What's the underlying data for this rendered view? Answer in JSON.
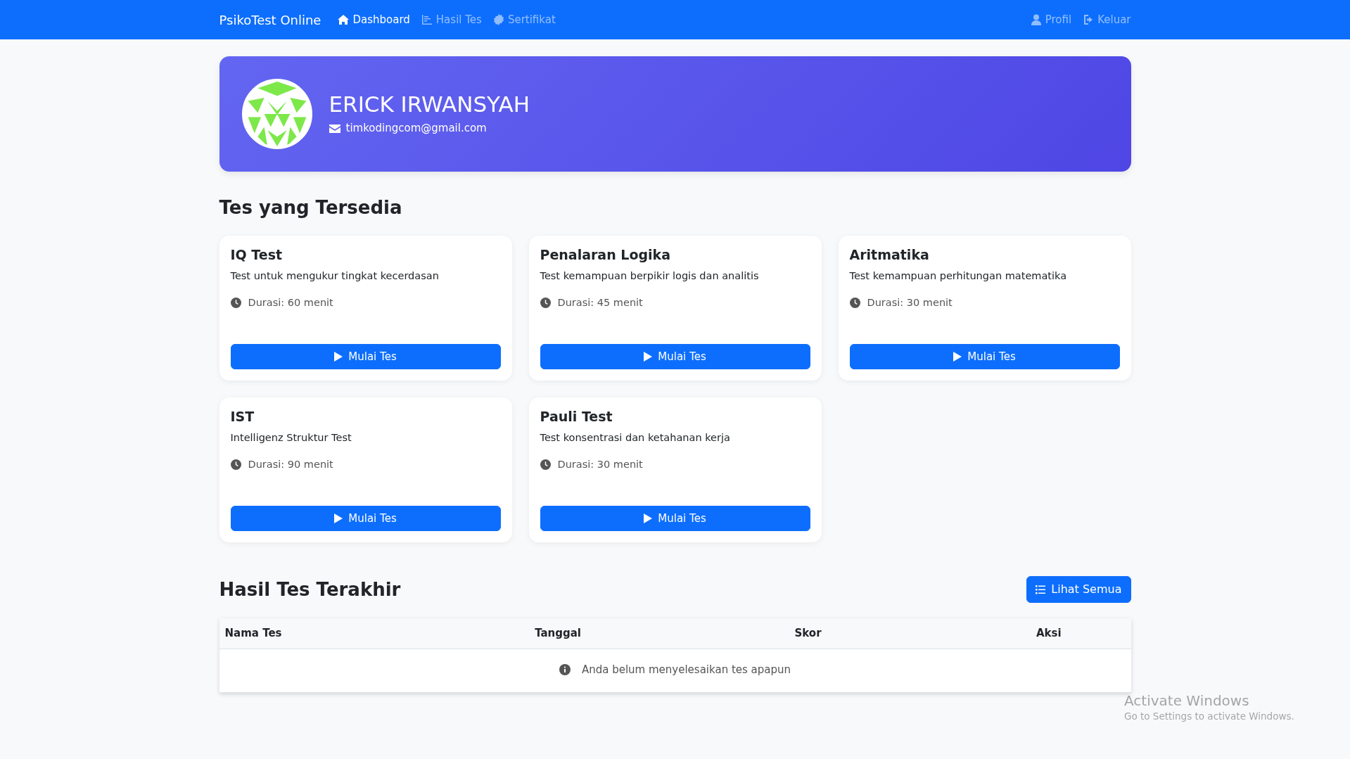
{
  "navbar": {
    "brand": "PsikoTest Online",
    "left_items": [
      {
        "label": "Dashboard",
        "selected": true
      },
      {
        "label": "Hasil Tes",
        "selected": false
      },
      {
        "label": "Sertifikat",
        "selected": false
      }
    ],
    "right_items": [
      {
        "label": "Profil",
        "selected": false
      },
      {
        "label": "Keluar",
        "selected": false
      }
    ]
  },
  "profile": {
    "name": "ERICK IRWANSYAH",
    "email": "timkodingcom@gmail.com"
  },
  "tests_section": {
    "title": "Tes yang Tersedia",
    "tests": [
      {
        "title": "IQ Test",
        "description": "Test untuk mengukur tingkat kecerdasan",
        "duration": "Durasi: 60 menit",
        "button": "Mulai Tes"
      },
      {
        "title": "Penalaran Logika",
        "description": "Test kemampuan berpikir logis dan analitis",
        "duration": "Durasi: 45 menit",
        "button": "Mulai Tes"
      },
      {
        "title": "Aritmatika",
        "description": "Test kemampuan perhitungan matematika",
        "duration": "Durasi: 30 menit",
        "button": "Mulai Tes"
      },
      {
        "title": "IST",
        "description": "Intelligenz Struktur Test",
        "duration": "Durasi: 90 menit",
        "button": "Mulai Tes"
      },
      {
        "title": "Pauli Test",
        "description": "Test konsentrasi dan ketahanan kerja",
        "duration": "Durasi: 30 menit",
        "button": "Mulai Tes"
      }
    ]
  },
  "results_section": {
    "title": "Hasil Tes Terakhir",
    "button": "Lihat Semua",
    "table": {
      "columns": [
        "Nama Tes",
        "Tanggal",
        "Skor",
        "Aksi"
      ],
      "empty_message": "Anda belum menyelesaikan tes apapun"
    }
  },
  "os_watermark": {
    "title": "Activate Windows",
    "subtitle": "Go to Settings to activate Windows."
  }
}
